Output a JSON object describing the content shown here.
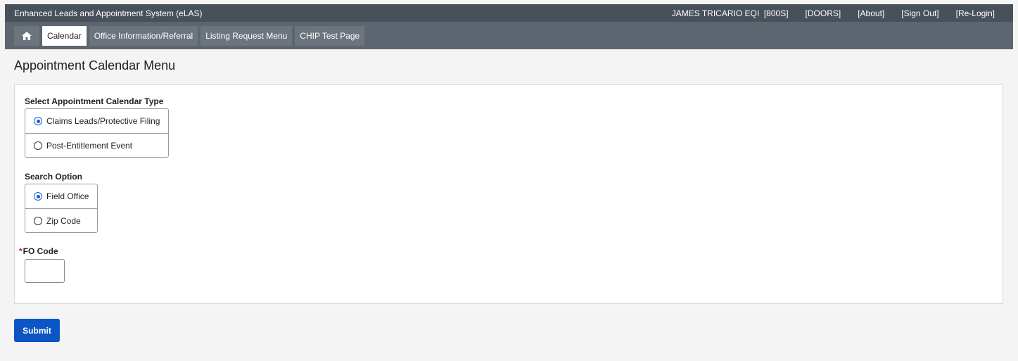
{
  "header": {
    "app_title": "Enhanced Leads and Appointment System (eLAS)",
    "user": "JAMES TRICARIO EQI  [800S]",
    "links": [
      "[DOORS]",
      "[About]",
      "[Sign Out]",
      "[Re-Login]"
    ]
  },
  "nav": {
    "home_icon": "home-icon",
    "items": [
      {
        "label": "Calendar",
        "active": true
      },
      {
        "label": "Office Information/Referral",
        "active": false
      },
      {
        "label": "Listing Request Menu",
        "active": false
      },
      {
        "label": "CHIP Test Page",
        "active": false
      }
    ]
  },
  "page": {
    "title": "Appointment Calendar Menu"
  },
  "form": {
    "calendar_type": {
      "label": "Select Appointment Calendar Type",
      "options": [
        "Claims Leads/Protective Filing",
        "Post-Entitlement Event"
      ],
      "selected": "Claims Leads/Protective Filing"
    },
    "search_option": {
      "label": "Search Option",
      "options": [
        "Field Office",
        "Zip Code"
      ],
      "selected": "Field Office"
    },
    "fo_code": {
      "required_mark": "*",
      "label": "FO Code",
      "value": ""
    },
    "submit_label": "Submit"
  },
  "colors": {
    "titlebar": "#48505a",
    "navbar": "#5d6670",
    "accent": "#0b55c7",
    "required": "#c0262d"
  }
}
